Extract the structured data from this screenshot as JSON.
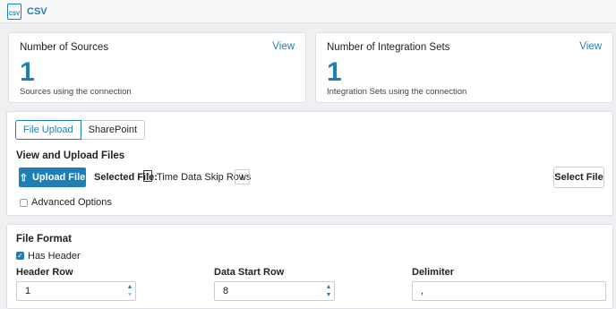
{
  "app": {
    "title": "CSV",
    "icon": "csv-file-icon",
    "icon_text": "CSV"
  },
  "stats": [
    {
      "label": "Number of Sources",
      "view_label": "View",
      "value": "1",
      "sub": "Sources using the connection"
    },
    {
      "label": "Number of Integration Sets",
      "view_label": "View",
      "value": "1",
      "sub": "Integration Sets using the connection"
    }
  ],
  "upload": {
    "tabs": [
      "File Upload",
      "SharePoint"
    ],
    "active_tab": "File Upload",
    "section_title": "View and Upload Files",
    "upload_button": "Upload File",
    "selected_file_label": "Selected File:",
    "selected_file_name": "Time Data Skip Rows",
    "select_file_button": "Select File",
    "advanced_options": {
      "label": "Advanced Options",
      "checked": false
    }
  },
  "file_format": {
    "title": "File Format",
    "has_header": {
      "label": "Has Header",
      "checked": true
    },
    "header_row": {
      "label": "Header Row",
      "value": "1"
    },
    "data_start_row": {
      "label": "Data Start Row",
      "value": "8"
    },
    "delimiter": {
      "label": "Delimiter",
      "value": ","
    }
  },
  "colors": {
    "accent": "#1f7fb2",
    "background": "#eef0f2",
    "card": "#ffffff",
    "border": "#dde1e5"
  }
}
